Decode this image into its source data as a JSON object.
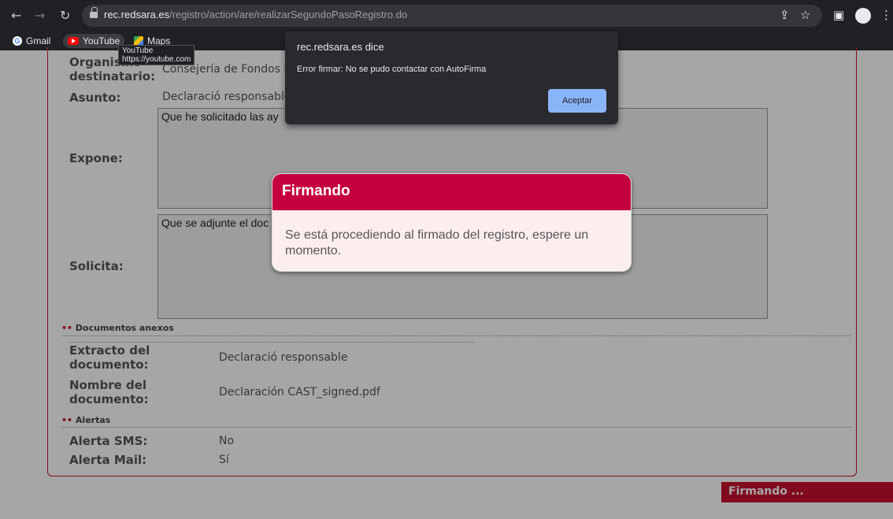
{
  "browser": {
    "url_domain": "rec.redsara.es",
    "url_path": "/registro/action/are/realizarSegundoPasoRegistro.do",
    "bookmarks": [
      "Gmail",
      "YouTube",
      "Maps"
    ],
    "tooltip_title": "YouTube",
    "tooltip_url": "https://youtube.com"
  },
  "form": {
    "organismo_label": "Organismo destinatario:",
    "organismo_value": "Consejería de Fondos E",
    "asunto_label": "Asunto:",
    "asunto_value": "Declaració responsable",
    "expone_label": "Expone:",
    "expone_value": "Que he solicitado las ay",
    "solicita_label": "Solicita:",
    "solicita_value": "Que se adjunte el doc",
    "section_documentos": "Documentos anexos",
    "extracto_label": "Extracto del documento:",
    "extracto_value": "Declaració responsable",
    "nombre_label": "Nombre del documento:",
    "nombre_value": "Declaración CAST_signed.pdf",
    "section_alertas": "Alertas",
    "sms_label": "Alerta SMS:",
    "sms_value": "No",
    "mail_label": "Alerta Mail:",
    "mail_value": "Sí"
  },
  "status_bar": "Firmando ...",
  "modal": {
    "title": "Firmando",
    "message": "Se está procediendo al firmado del registro, espere un momento."
  },
  "alert": {
    "title": "rec.redsara.es dice",
    "message": "Error firmar: No se pudo contactar con AutoFirma",
    "button": "Aceptar"
  }
}
